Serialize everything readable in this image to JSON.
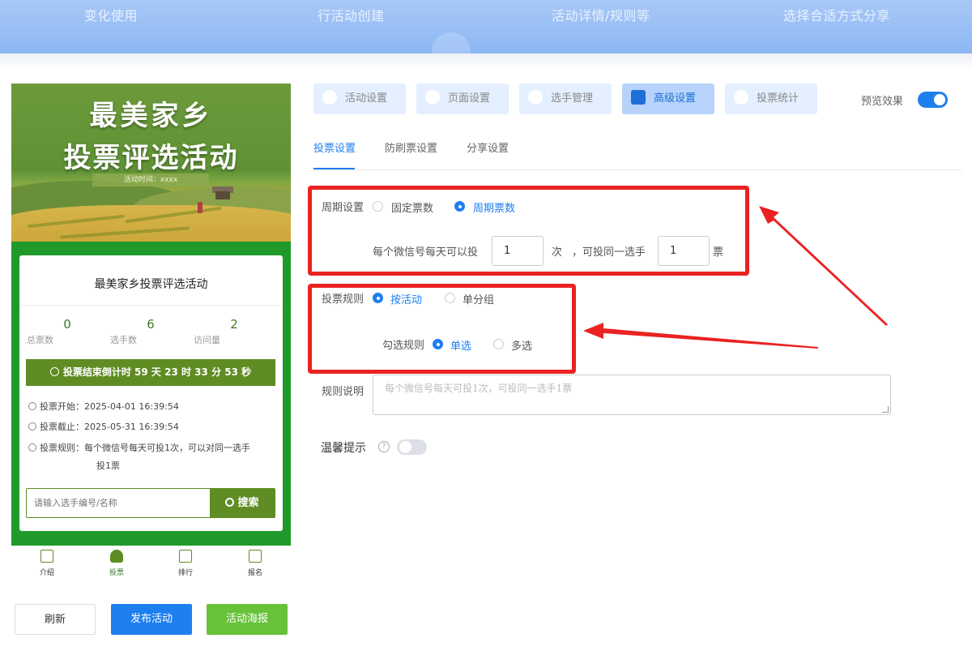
{
  "banner": {
    "steps": [
      "变化使用",
      "行活动创建",
      "活动详情/规则等",
      "选择合适方式分享"
    ]
  },
  "preview": {
    "hero_title_line1": "最美家乡",
    "hero_title_line2": "投票评选活动",
    "hero_time": "活动时间：xxxx",
    "card_title": "最美家乡投票评选活动",
    "stats": [
      {
        "value": "0",
        "label": "总票数"
      },
      {
        "value": "6",
        "label": "选手数"
      },
      {
        "value": "2",
        "label": "访问量"
      }
    ],
    "countdown": "投票结束倒计时 59 天 23 时 33 分 53 秒",
    "start": "投票开始：2025-04-01 16:39:54",
    "end": "投票截止：2025-05-31 16:39:54",
    "rule_line1": "投票规则：每个微信号每天可投1次，可以对同一选手",
    "rule_line2": "投1票",
    "search_placeholder": "请输入选手编号/名称",
    "search_button": "搜索",
    "tabs": [
      "介绍",
      "投票",
      "排行",
      "报名"
    ],
    "accent_color": "#5f8c23"
  },
  "actions": {
    "refresh": "刷新",
    "publish": "发布活动",
    "poster": "活动海报"
  },
  "nav": {
    "items": [
      "活动设置",
      "页面设置",
      "选手管理",
      "高级设置",
      "投票统计"
    ],
    "active": "高级设置",
    "preview_label": "预览效果",
    "preview_on": true
  },
  "subtabs": [
    "投票设置",
    "防刷票设置",
    "分享设置"
  ],
  "form": {
    "period_label": "周期设置",
    "period_opt1": "固定票数",
    "period_opt2": "周期票数",
    "per_day_prefix": "每个微信号每天可以投",
    "per_day_value": "1",
    "per_day_unit": "次",
    "same_prefix": "，可投同一选手",
    "same_value": "1",
    "same_unit": "票",
    "rule_label": "投票规则",
    "rule_opt1": "按活动",
    "rule_opt2": "单分组",
    "check_label": "勾选规则",
    "check_opt1": "单选",
    "check_opt2": "多选",
    "desc_label": "规则说明",
    "desc_placeholder": "每个微信号每天可投1次，可投同一选手1票",
    "tip_label": "温馨提示",
    "tip_on": false
  },
  "colors": {
    "primary": "#1e7fef",
    "annotation": "#ea2222"
  }
}
